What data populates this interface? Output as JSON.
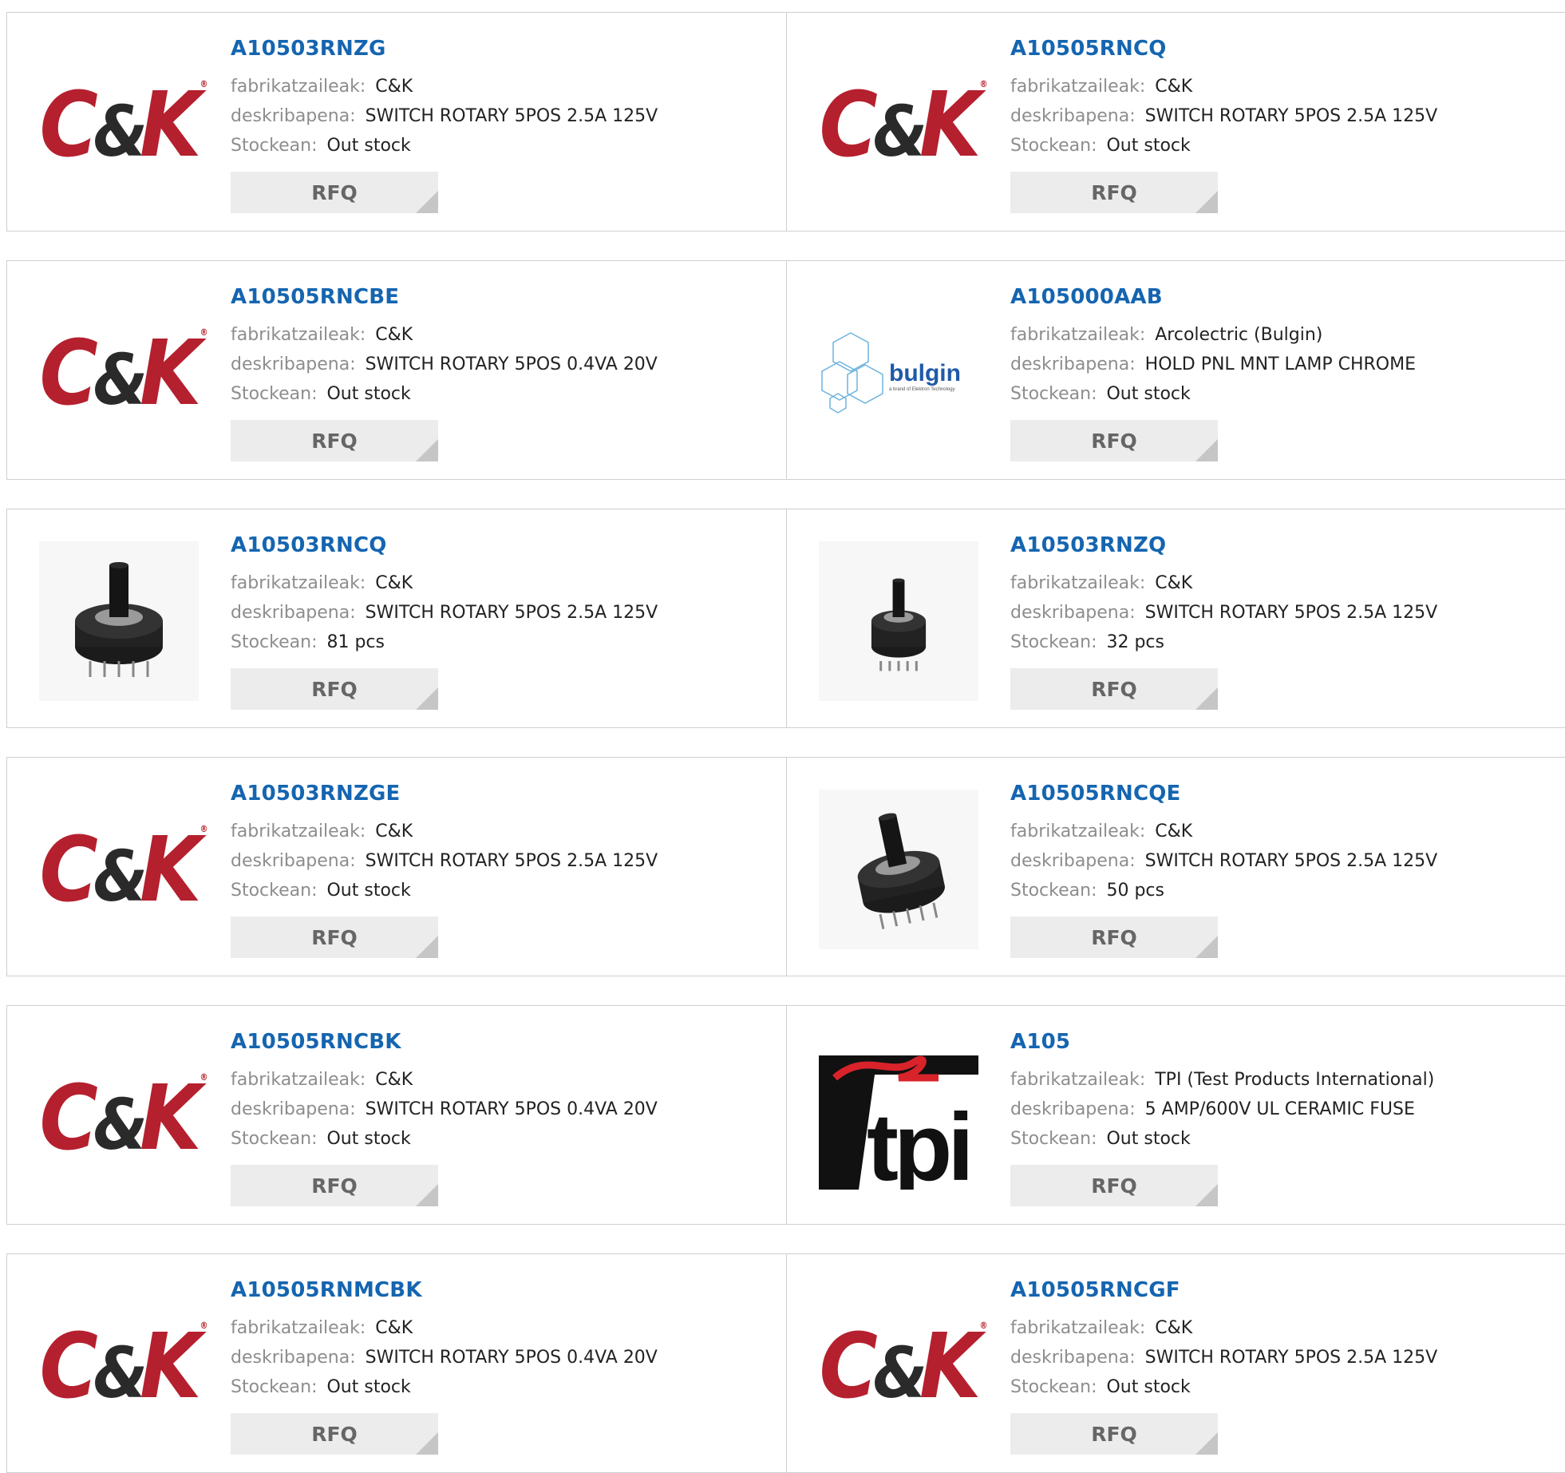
{
  "labels": {
    "manufacturer": "fabrikatzaileak:",
    "description": "deskribapena:",
    "stock": "Stockean:",
    "rfq": "RFQ"
  },
  "products": [
    {
      "pn": "A10503RNZG",
      "manufacturer": "C&K",
      "description": "SWITCH ROTARY 5POS 2.5A 125V",
      "stock": "Out stock",
      "image": "ck-logo"
    },
    {
      "pn": "A10505RNCQ",
      "manufacturer": "C&K",
      "description": "SWITCH ROTARY 5POS 2.5A 125V",
      "stock": "Out stock",
      "image": "ck-logo"
    },
    {
      "pn": "A10505RNCBE",
      "manufacturer": "C&K",
      "description": "SWITCH ROTARY 5POS 0.4VA 20V",
      "stock": "Out stock",
      "image": "ck-logo"
    },
    {
      "pn": "A105000AAB",
      "manufacturer": "Arcolectric (Bulgin)",
      "description": "HOLD PNL MNT LAMP CHROME",
      "stock": "Out stock",
      "image": "bulgin-logo",
      "logo_text": "bulgin",
      "logo_tagline": "a brand of Elektron Technology"
    },
    {
      "pn": "A10503RNCQ",
      "manufacturer": "C&K",
      "description": "SWITCH ROTARY 5POS 2.5A 125V",
      "stock": "81 pcs",
      "image": "rotary-switch-photo"
    },
    {
      "pn": "A10503RNZQ",
      "manufacturer": "C&K",
      "description": "SWITCH ROTARY 5POS 2.5A 125V",
      "stock": "32 pcs",
      "image": "rotary-switch-photo-small"
    },
    {
      "pn": "A10503RNZGE",
      "manufacturer": "C&K",
      "description": "SWITCH ROTARY 5POS 2.5A 125V",
      "stock": "Out stock",
      "image": "ck-logo"
    },
    {
      "pn": "A10505RNCQE",
      "manufacturer": "C&K",
      "description": "SWITCH ROTARY 5POS 2.5A 125V",
      "stock": "50 pcs",
      "image": "rotary-switch-photo-angled"
    },
    {
      "pn": "A10505RNCBK",
      "manufacturer": "C&K",
      "description": "SWITCH ROTARY 5POS 0.4VA 20V",
      "stock": "Out stock",
      "image": "ck-logo"
    },
    {
      "pn": "A105",
      "manufacturer": "TPI (Test Products International)",
      "description": "5 AMP/600V UL CERAMIC FUSE",
      "stock": "Out stock",
      "image": "tpi-logo",
      "logo_text": "tpi"
    },
    {
      "pn": "A10505RNMCBK",
      "manufacturer": "C&K",
      "description": "SWITCH ROTARY 5POS 0.4VA 20V",
      "stock": "Out stock",
      "image": "ck-logo"
    },
    {
      "pn": "A10505RNCGF",
      "manufacturer": "C&K",
      "description": "SWITCH ROTARY 5POS 2.5A 125V",
      "stock": "Out stock",
      "image": "ck-logo"
    }
  ],
  "colors": {
    "link": "#1565b0",
    "label": "#8d8d8d",
    "value": "#222222",
    "ck_red": "#b5202e",
    "button_bg": "#ececec",
    "border": "#cfcfcf",
    "bulgin_blue": "#1e5aa8",
    "tpi_red": "#d8232a"
  }
}
